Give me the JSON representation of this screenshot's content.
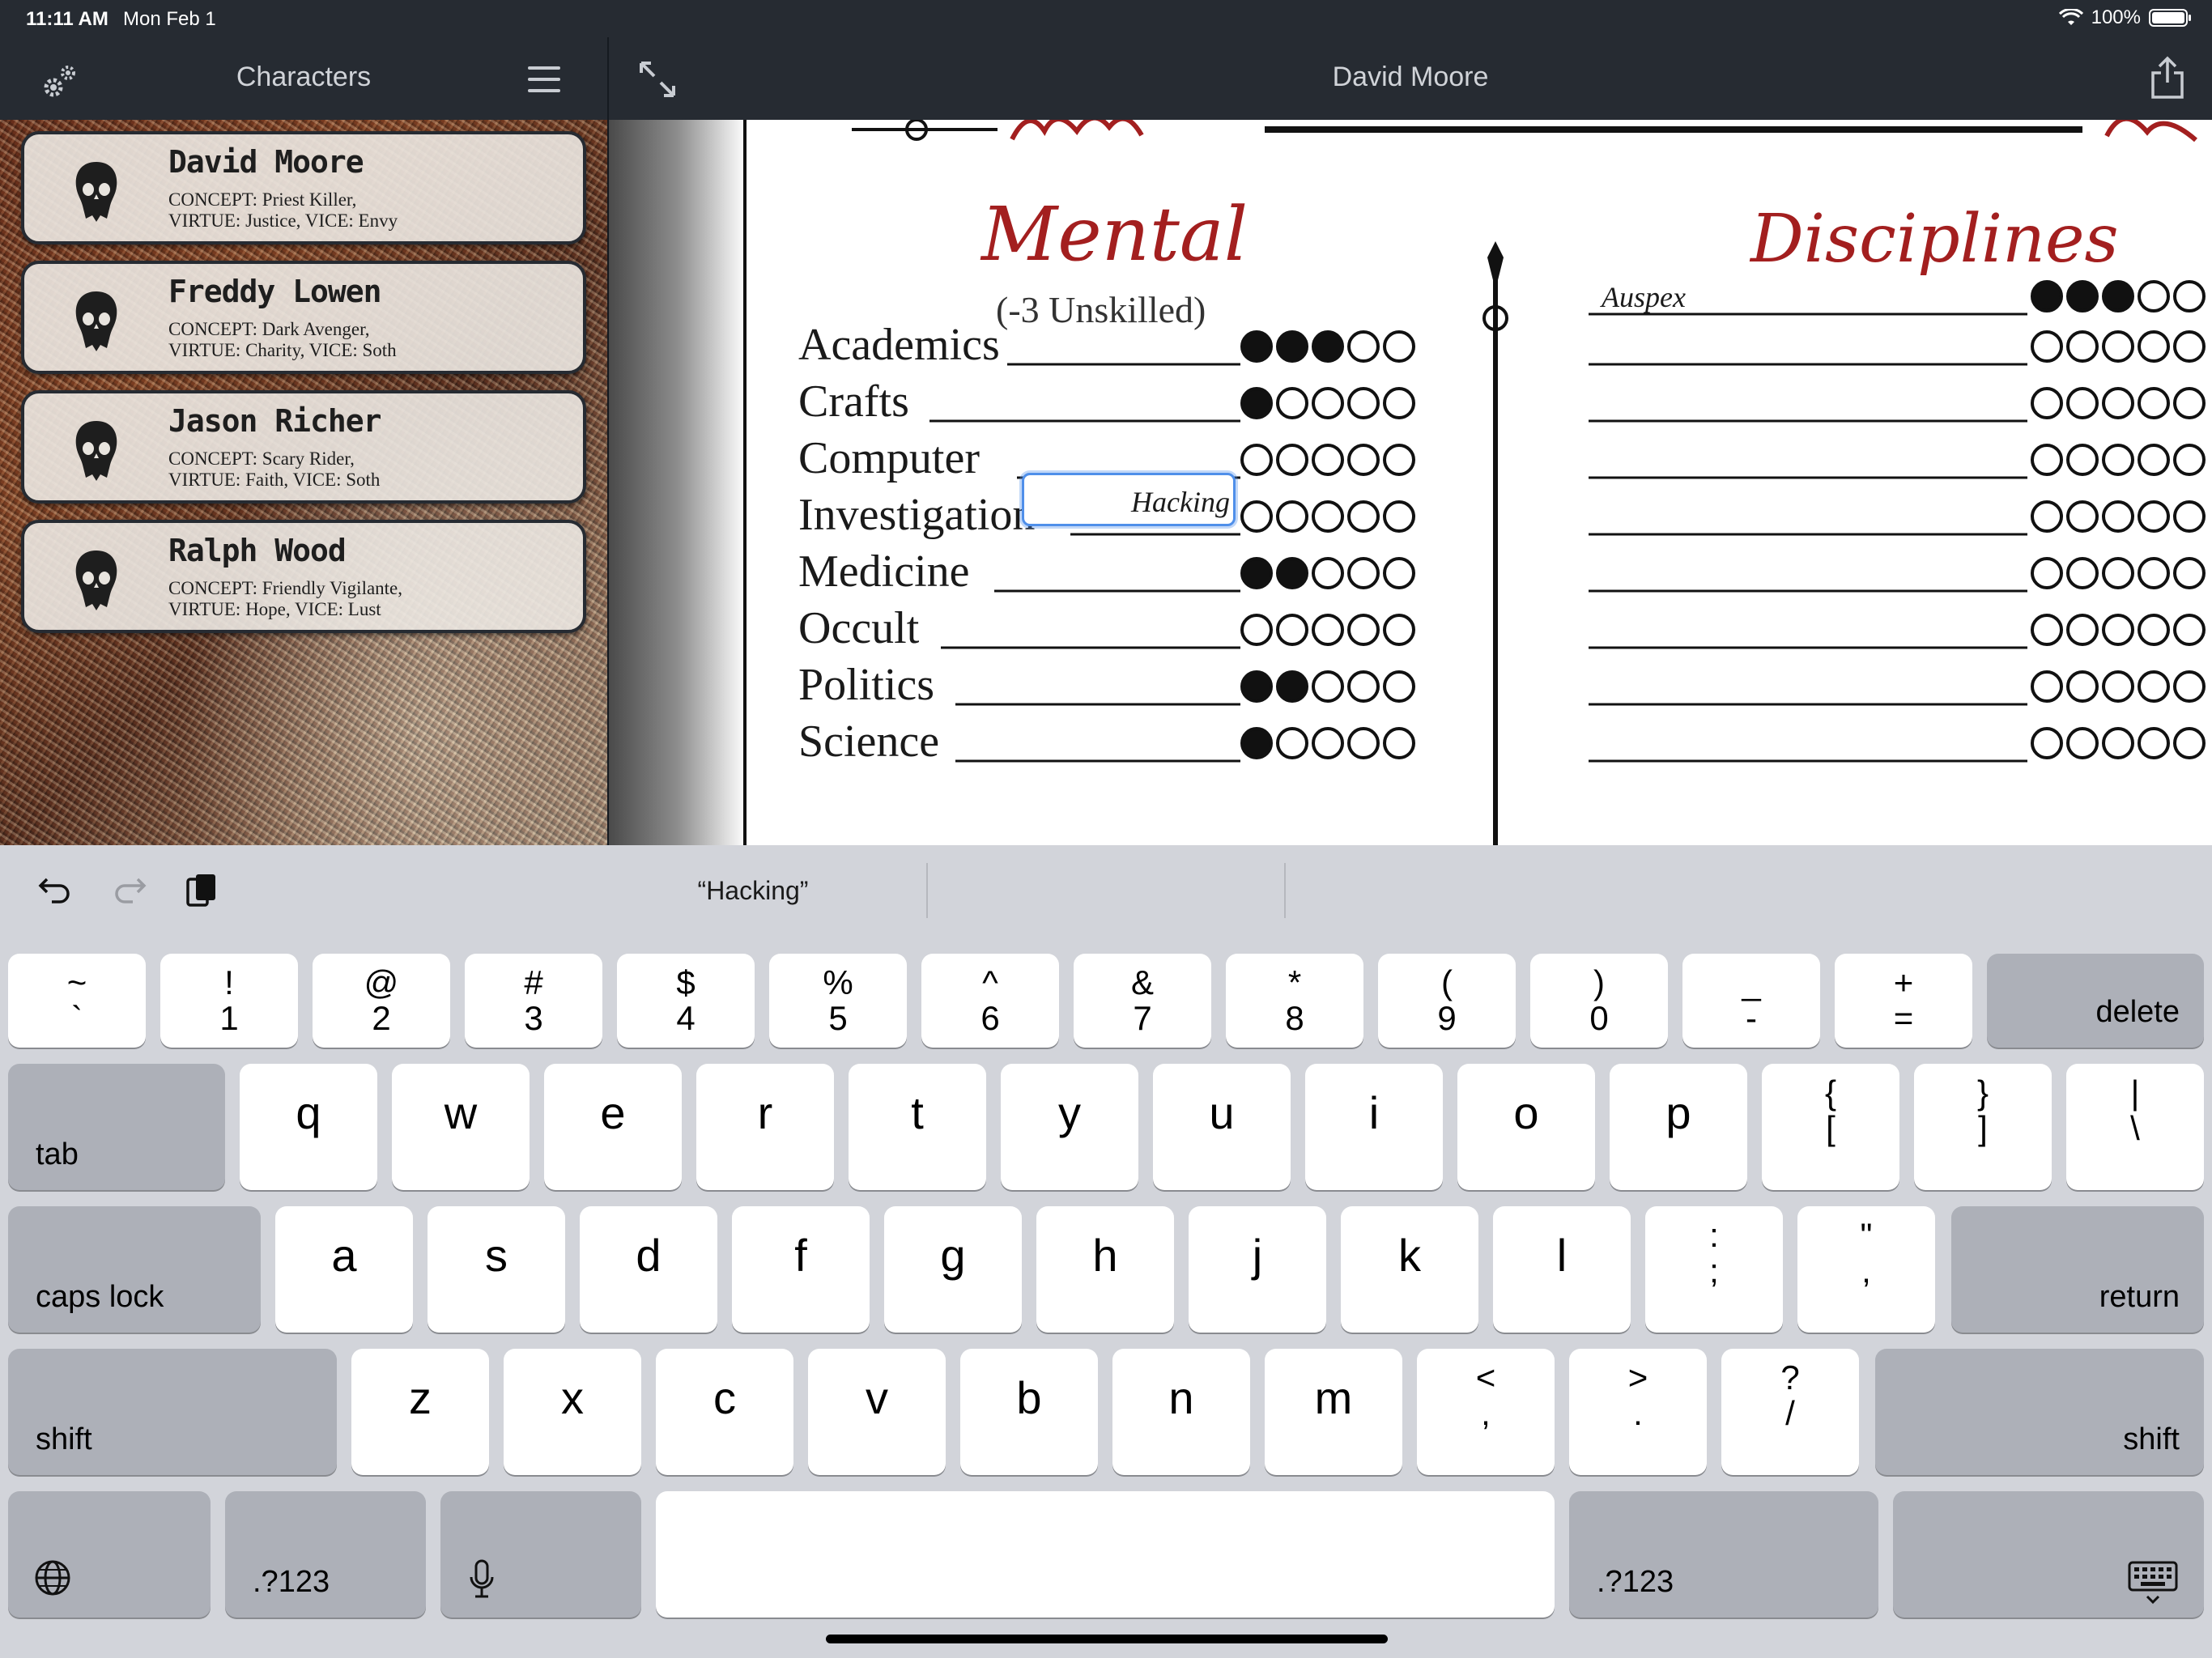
{
  "status_bar": {
    "time": "11:11 AM",
    "date": "Mon Feb 1",
    "battery": "100%",
    "battery_level": 1.0
  },
  "sidebar": {
    "title": "Characters",
    "characters": [
      {
        "name": "David Moore",
        "concept": "CONCEPT: Priest Killer,",
        "virtue_vice": "VIRTUE: Justice, VICE: Envy"
      },
      {
        "name": "Freddy Lowen",
        "concept": "CONCEPT: Dark Avenger,",
        "virtue_vice": "VIRTUE: Charity, VICE: Soth"
      },
      {
        "name": "Jason Richer",
        "concept": "CONCEPT: Scary Rider,",
        "virtue_vice": "VIRTUE: Faith, VICE: Soth"
      },
      {
        "name": "Ralph Wood",
        "concept": "CONCEPT: Friendly Vigilante,",
        "virtue_vice": "VIRTUE: Hope, VICE: Lust"
      }
    ]
  },
  "sheet": {
    "title": "David Moore",
    "mental": {
      "heading": "Mental",
      "note": "(-3 Unskilled)",
      "skills": [
        {
          "name": "Academics",
          "rating": 3
        },
        {
          "name": "Crafts",
          "rating": 1
        },
        {
          "name": "Computer",
          "rating": 0,
          "specialty": "Hacking"
        },
        {
          "name": "Investigation",
          "rating": 0
        },
        {
          "name": "Medicine",
          "rating": 2
        },
        {
          "name": "Occult",
          "rating": 0
        },
        {
          "name": "Politics",
          "rating": 2
        },
        {
          "name": "Science",
          "rating": 1
        }
      ]
    },
    "disciplines": {
      "heading": "Disciplines",
      "rows": [
        {
          "name": "Auspex",
          "rating": 3
        },
        {
          "name": "",
          "rating": 0
        },
        {
          "name": "",
          "rating": 0
        },
        {
          "name": "",
          "rating": 0
        },
        {
          "name": "",
          "rating": 0
        },
        {
          "name": "",
          "rating": 0
        },
        {
          "name": "",
          "rating": 0
        },
        {
          "name": "",
          "rating": 0
        },
        {
          "name": "",
          "rating": 0
        }
      ]
    }
  },
  "keyboard": {
    "suggestion": "“Hacking”",
    "row_numbers": [
      {
        "top": "~",
        "bottom": "`"
      },
      {
        "top": "!",
        "bottom": "1"
      },
      {
        "top": "@",
        "bottom": "2"
      },
      {
        "top": "#",
        "bottom": "3"
      },
      {
        "top": "$",
        "bottom": "4"
      },
      {
        "top": "%",
        "bottom": "5"
      },
      {
        "top": "^",
        "bottom": "6"
      },
      {
        "top": "&",
        "bottom": "7"
      },
      {
        "top": "*",
        "bottom": "8"
      },
      {
        "top": "(",
        "bottom": "9"
      },
      {
        "top": ")",
        "bottom": "0"
      },
      {
        "top": "_",
        "bottom": "-"
      },
      {
        "top": "+",
        "bottom": "="
      }
    ],
    "row_q": [
      "q",
      "w",
      "e",
      "r",
      "t",
      "y",
      "u",
      "i",
      "o",
      "p"
    ],
    "row_q_extra": [
      {
        "top": "{",
        "bottom": "["
      },
      {
        "top": "}",
        "bottom": "]"
      },
      {
        "top": "|",
        "bottom": "\\"
      }
    ],
    "row_a": [
      "a",
      "s",
      "d",
      "f",
      "g",
      "h",
      "j",
      "k",
      "l"
    ],
    "row_a_extra": [
      {
        "top": ":",
        "bottom": ";"
      },
      {
        "top": "\"",
        "bottom": ","
      }
    ],
    "row_z": [
      "z",
      "x",
      "c",
      "v",
      "b",
      "n",
      "m"
    ],
    "row_z_extra": [
      {
        "top": "<",
        "bottom": ","
      },
      {
        "top": ">",
        "bottom": "."
      },
      {
        "top": "?",
        "bottom": "/"
      }
    ],
    "delete": "delete",
    "tab": "tab",
    "caps": "caps lock",
    "return": "return",
    "shift": "shift",
    "num": ".?123"
  }
}
